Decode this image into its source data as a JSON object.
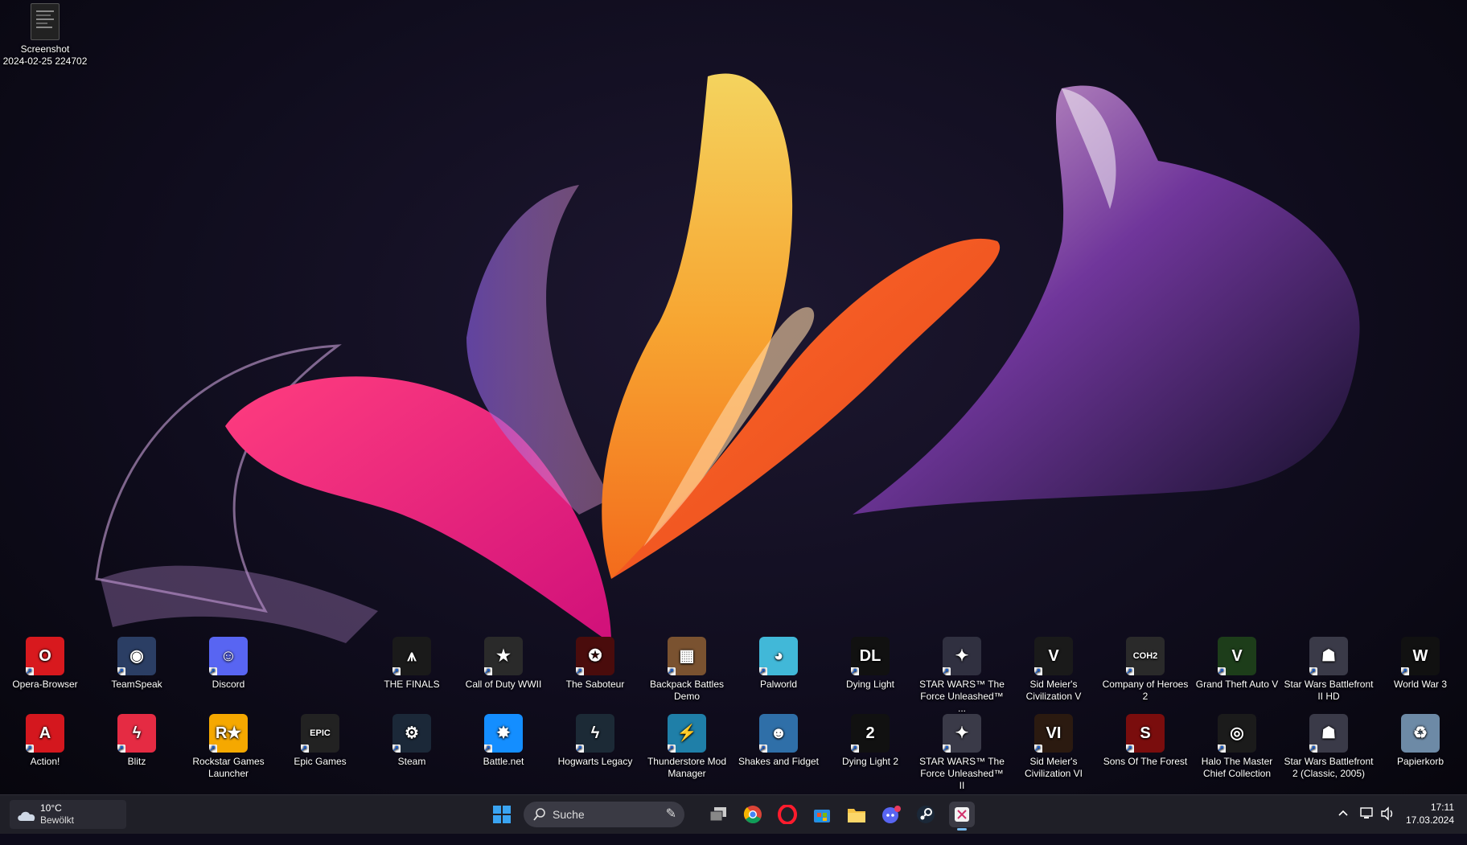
{
  "desktop": {
    "top_icons": [
      {
        "label": "Screenshot\n2024-02-25 224702",
        "icon": "image-file-icon"
      }
    ],
    "row1": [
      {
        "label": "Opera-Browser",
        "icon": "opera-icon",
        "color": "#d8191e",
        "text": "O"
      },
      {
        "label": "TeamSpeak",
        "icon": "teamspeak-icon",
        "color": "#2b3e64",
        "text": "◉"
      },
      {
        "label": "Discord",
        "icon": "discord-icon",
        "color": "#5865f2",
        "text": "☺"
      },
      {
        "label": "THE FINALS",
        "icon": "the-finals-icon",
        "color": "#1a1a1a",
        "text": "⩚"
      },
      {
        "label": "Call of Duty WWII",
        "icon": "call-of-duty-icon",
        "color": "#2a2a2a",
        "text": "★"
      },
      {
        "label": "The Saboteur",
        "icon": "the-saboteur-icon",
        "color": "#4a0c0c",
        "text": "✪"
      },
      {
        "label": "Backpack Battles\nDemo",
        "icon": "backpack-icon",
        "color": "#7a5230",
        "text": "▦"
      },
      {
        "label": "Palworld",
        "icon": "palworld-icon",
        "color": "#41b8d8",
        "text": "◕"
      },
      {
        "label": "Dying Light",
        "icon": "dying-light-icon",
        "color": "#111111",
        "text": "DL"
      },
      {
        "label": "STAR WARS™ The\nForce Unleashed™ ...",
        "icon": "star-wars-tfu-icon",
        "color": "#303040",
        "text": "✦"
      },
      {
        "label": "Sid Meier's\nCivilization V",
        "icon": "civilization-v-icon",
        "color": "#1a1a1a",
        "text": "V"
      },
      {
        "label": "Company of Heroes\n2",
        "icon": "coh2-icon",
        "color": "#2a2a2a",
        "text": "COH2"
      },
      {
        "label": "Grand Theft Auto V",
        "icon": "gta-v-icon",
        "color": "#1d3d1a",
        "text": "V"
      },
      {
        "label": "Star Wars Battlefront\nII HD",
        "icon": "battlefront-icon",
        "color": "#3a3a48",
        "text": "☗"
      },
      {
        "label": "World War 3",
        "icon": "world-war-3-icon",
        "color": "#111111",
        "text": "W"
      }
    ],
    "row2": [
      {
        "label": "Action!",
        "icon": "action-icon",
        "color": "#d4171e",
        "text": "A"
      },
      {
        "label": "Blitz",
        "icon": "blitz-icon",
        "color": "#e52b43",
        "text": "ϟ"
      },
      {
        "label": "Rockstar Games\nLauncher",
        "icon": "rockstar-icon",
        "color": "#f5a800",
        "text": "R★"
      },
      {
        "label": "Epic Games",
        "icon": "epic-games-icon",
        "color": "#222222",
        "text": "EPIC"
      },
      {
        "label": "Steam",
        "icon": "steam-icon",
        "color": "#1b2838",
        "text": "⚙"
      },
      {
        "label": "Battle.net",
        "icon": "battlenet-icon",
        "color": "#148eff",
        "text": "✸"
      },
      {
        "label": "Hogwarts Legacy",
        "icon": "hogwarts-legacy-icon",
        "color": "#1c2a36",
        "text": "ϟ"
      },
      {
        "label": "Thunderstore Mod\nManager",
        "icon": "thunderstore-icon",
        "color": "#1f7fa8",
        "text": "⚡"
      },
      {
        "label": "Shakes and Fidget",
        "icon": "shakes-fidget-icon",
        "color": "#2f6fa8",
        "text": "☻"
      },
      {
        "label": "Dying Light 2",
        "icon": "dying-light-2-icon",
        "color": "#111111",
        "text": "2"
      },
      {
        "label": "STAR WARS™ The\nForce Unleashed™ II",
        "icon": "star-wars-tfu2-icon",
        "color": "#3a3a48",
        "text": "✦"
      },
      {
        "label": "Sid Meier's\nCivilization VI",
        "icon": "civilization-vi-icon",
        "color": "#2b1a10",
        "text": "VI"
      },
      {
        "label": "Sons Of The Forest",
        "icon": "sons-forest-icon",
        "color": "#7a0d0d",
        "text": "S"
      },
      {
        "label": "Halo The Master\nChief Collection",
        "icon": "halo-icon",
        "color": "#1b1b1b",
        "text": "◎"
      },
      {
        "label": "Star Wars Battlefront\n2 (Classic, 2005)",
        "icon": "battlefront-classic-icon",
        "color": "#3a3a48",
        "text": "☗"
      },
      {
        "label": "Papierkorb",
        "icon": "recycle-bin-icon",
        "color": "#6d8aa6",
        "text": "♻"
      }
    ]
  },
  "taskbar": {
    "weather_temp": "10°C",
    "weather_desc": "Bewölkt",
    "search_placeholder": "Suche",
    "pinned": [
      "task-view-icon",
      "chrome-icon",
      "opera-icon",
      "microsoft-store-icon",
      "file-explorer-icon",
      "discord-icon",
      "steam-icon",
      "snipping-tool-icon"
    ],
    "time": "17:11",
    "date": "17.03.2024"
  }
}
